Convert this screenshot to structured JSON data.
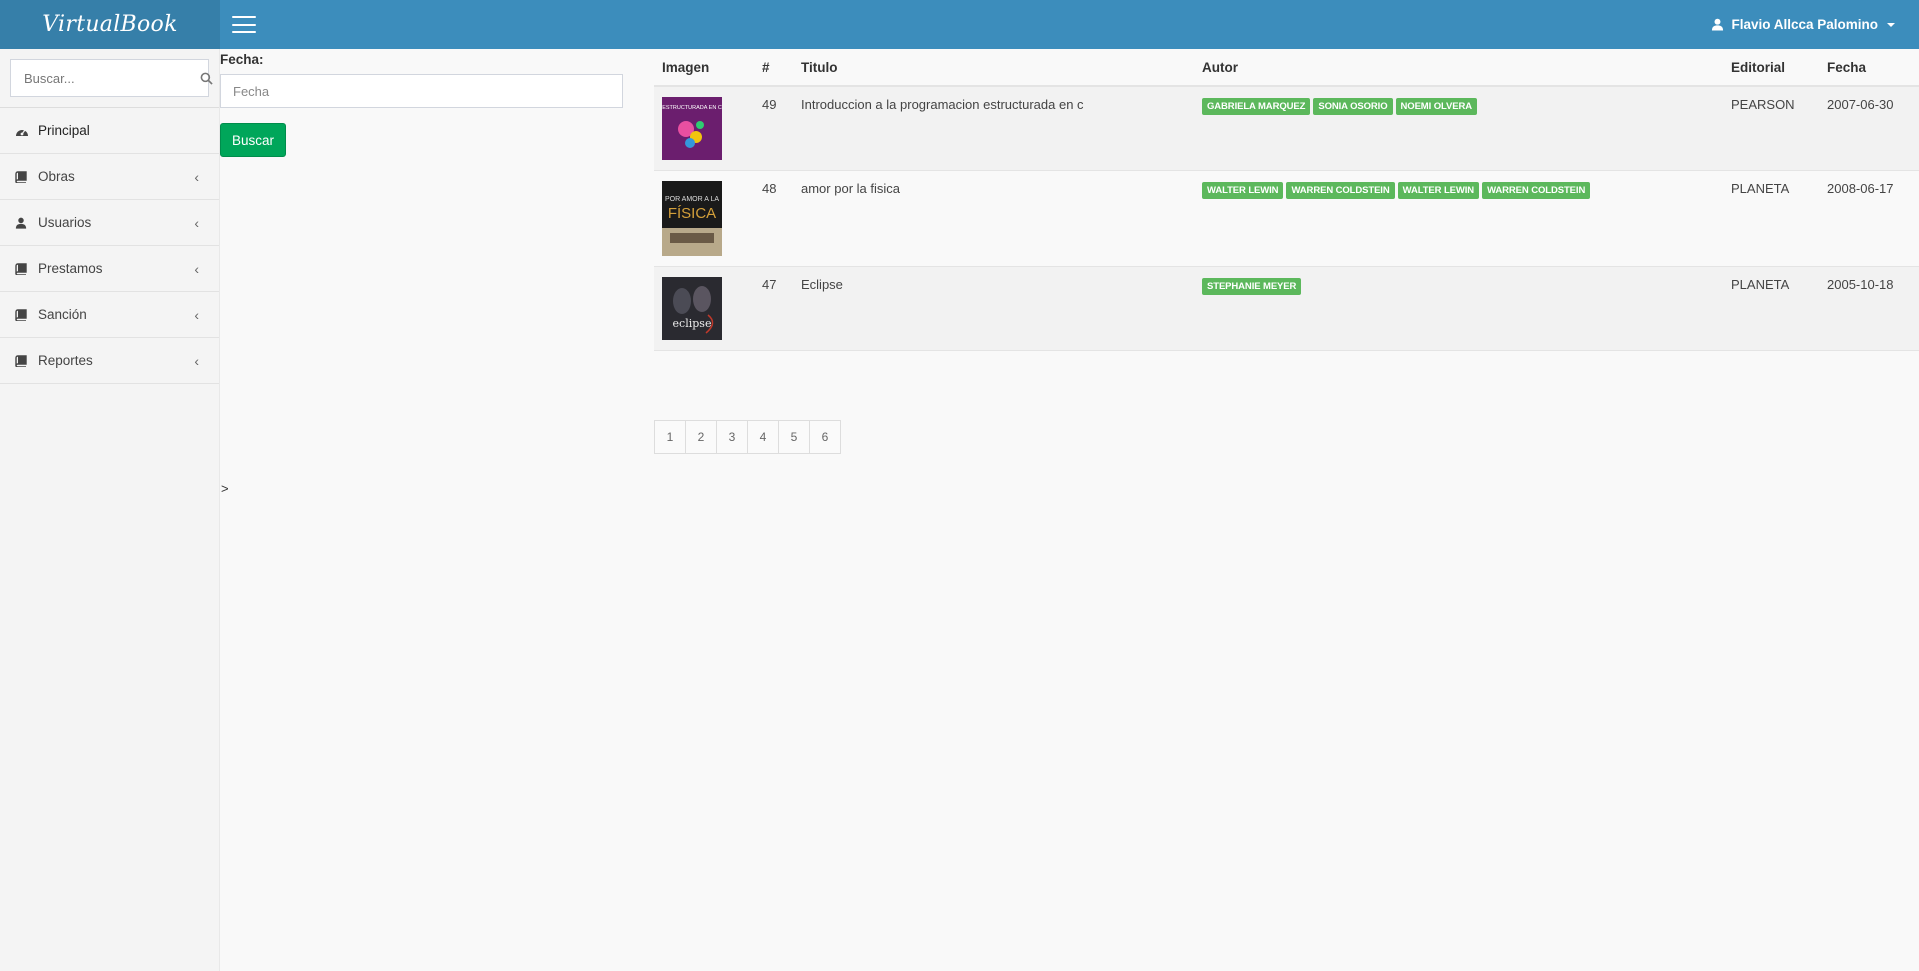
{
  "app": {
    "title": "VirtualBook"
  },
  "header": {
    "user_name": "Flavio Allcca Palomino"
  },
  "sidebar": {
    "search_placeholder": "Buscar...",
    "items": [
      {
        "label": "Principal",
        "icon": "dashboard-icon",
        "has_arrow": false
      },
      {
        "label": "Obras",
        "icon": "book-icon",
        "has_arrow": true
      },
      {
        "label": "Usuarios",
        "icon": "user-icon",
        "has_arrow": true
      },
      {
        "label": "Prestamos",
        "icon": "book-icon",
        "has_arrow": true
      },
      {
        "label": "Sanción",
        "icon": "book-icon",
        "has_arrow": true
      },
      {
        "label": "Reportes",
        "icon": "book-icon",
        "has_arrow": true
      }
    ]
  },
  "filter": {
    "label": "Fecha:",
    "placeholder": "Fecha",
    "button": "Buscar"
  },
  "stray_text": ">",
  "table": {
    "headers": [
      "Imagen",
      "#",
      "Titulo",
      "Autor",
      "Editorial",
      "Fecha"
    ],
    "rows": [
      {
        "id": "49",
        "title": "Introduccion a la programacion estructurada en c",
        "authors": [
          "GABRIELA MARQUEZ",
          "SONIA OSORIO",
          "NOEMI OLVERA"
        ],
        "publisher": "PEARSON",
        "date": "2007-06-30",
        "cover": {
          "lines": [
            "ESTRUCTURADA EN C"
          ],
          "bg": "#6b1e6e",
          "accent": "#e94fa1"
        }
      },
      {
        "id": "48",
        "title": "amor por la fisica",
        "authors": [
          "WALTER LEWIN",
          "WARREN COLDSTEIN",
          "WALTER LEWIN",
          "WARREN COLDSTEIN"
        ],
        "publisher": "PLANETA",
        "date": "2008-06-17",
        "cover": {
          "lines": [
            "POR AMOR A LA",
            "FÍSICA"
          ],
          "bg": "#1a1a1a",
          "accent": "#d4a03a"
        }
      },
      {
        "id": "47",
        "title": "Eclipse",
        "authors": [
          "STEPHANIE MEYER"
        ],
        "publisher": "PLANETA",
        "date": "2005-10-18",
        "cover": {
          "lines": [
            "eclipse"
          ],
          "bg": "#2a2a30",
          "accent": "#c0392b"
        }
      }
    ]
  },
  "pagination": [
    "1",
    "2",
    "3",
    "4",
    "5",
    "6"
  ],
  "colors": {
    "header": "#3c8dbc",
    "logo_bg": "#367fa9",
    "badge": "#5cb85c",
    "button": "#00a65a"
  }
}
